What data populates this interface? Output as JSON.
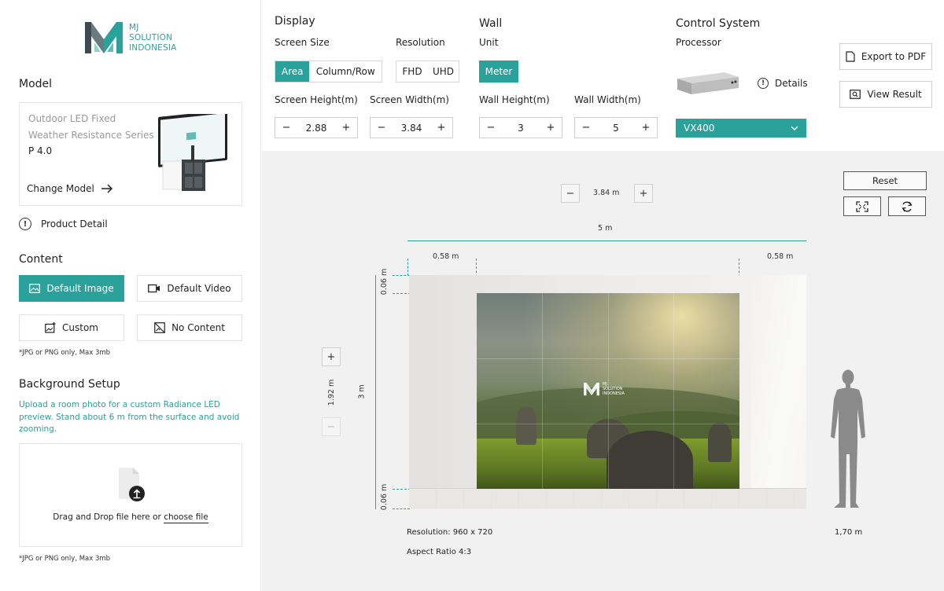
{
  "brand": {
    "logo_line1": "MJ",
    "logo_line2": "SOLUTION",
    "logo_line3": "INDONESIA",
    "accent": "#2aa19a"
  },
  "sidebar": {
    "model": {
      "title": "Model",
      "line1": "Outdoor LED Fixed",
      "line2": "Weather Resistance Series",
      "pitch": "P 4.0",
      "change_label": "Change Model",
      "product_detail": "Product Detail"
    },
    "content": {
      "title": "Content",
      "default_image": "Default Image",
      "default_video": "Default Video",
      "custom": "Custom",
      "no_content": "No Content",
      "note": "*JPG or PNG only, Max 3mb"
    },
    "background": {
      "title": "Background Setup",
      "description": "Upload a room photo for a custom Radiance LED preview. Stand about 6 m from the surface and avoid zooming.",
      "drop_text": "Drag and Drop file here or ",
      "drop_link": "choose file",
      "note": "*JPG or PNG only, Max 3mb"
    }
  },
  "display": {
    "title": "Display",
    "screen_size_label": "Screen Size",
    "size_options": [
      "Area",
      "Column/Row"
    ],
    "resolution_label": "Resolution",
    "resolution_options": [
      "FHD",
      "UHD"
    ],
    "screen_height_label": "Screen Height(m)",
    "screen_height": "2.88",
    "screen_width_label": "Screen Width(m)",
    "screen_width": "3.84"
  },
  "wall": {
    "title": "Wall",
    "unit_label": "Unit",
    "unit_value": "Meter",
    "wall_height_label": "Wall Height(m)",
    "wall_height": "3",
    "wall_width_label": "Wall Width(m)",
    "wall_width": "5"
  },
  "control": {
    "title": "Control System",
    "processor_label": "Processor",
    "details_label": "Details",
    "processor_value": "VX400"
  },
  "actions": {
    "export_pdf": "Export to PDF",
    "view_result": "View Result"
  },
  "canvas": {
    "reset": "Reset",
    "top_width": "3.84 m",
    "wall_width": "5 m",
    "left_margin": "0.58 m",
    "right_margin": "0.58 m",
    "top_margin": "0.06 m",
    "bottom_margin": "0.06 m",
    "height_offset": "1.92 m",
    "wall_height": "3 m",
    "resolution": "Resolution: 960 x 720",
    "aspect": "Aspect Ratio 4:3",
    "person_height": "1,70 m",
    "screen_logo_l1": "MJ",
    "screen_logo_l2": "SOLUTION",
    "screen_logo_l3": "INDONESIA"
  }
}
